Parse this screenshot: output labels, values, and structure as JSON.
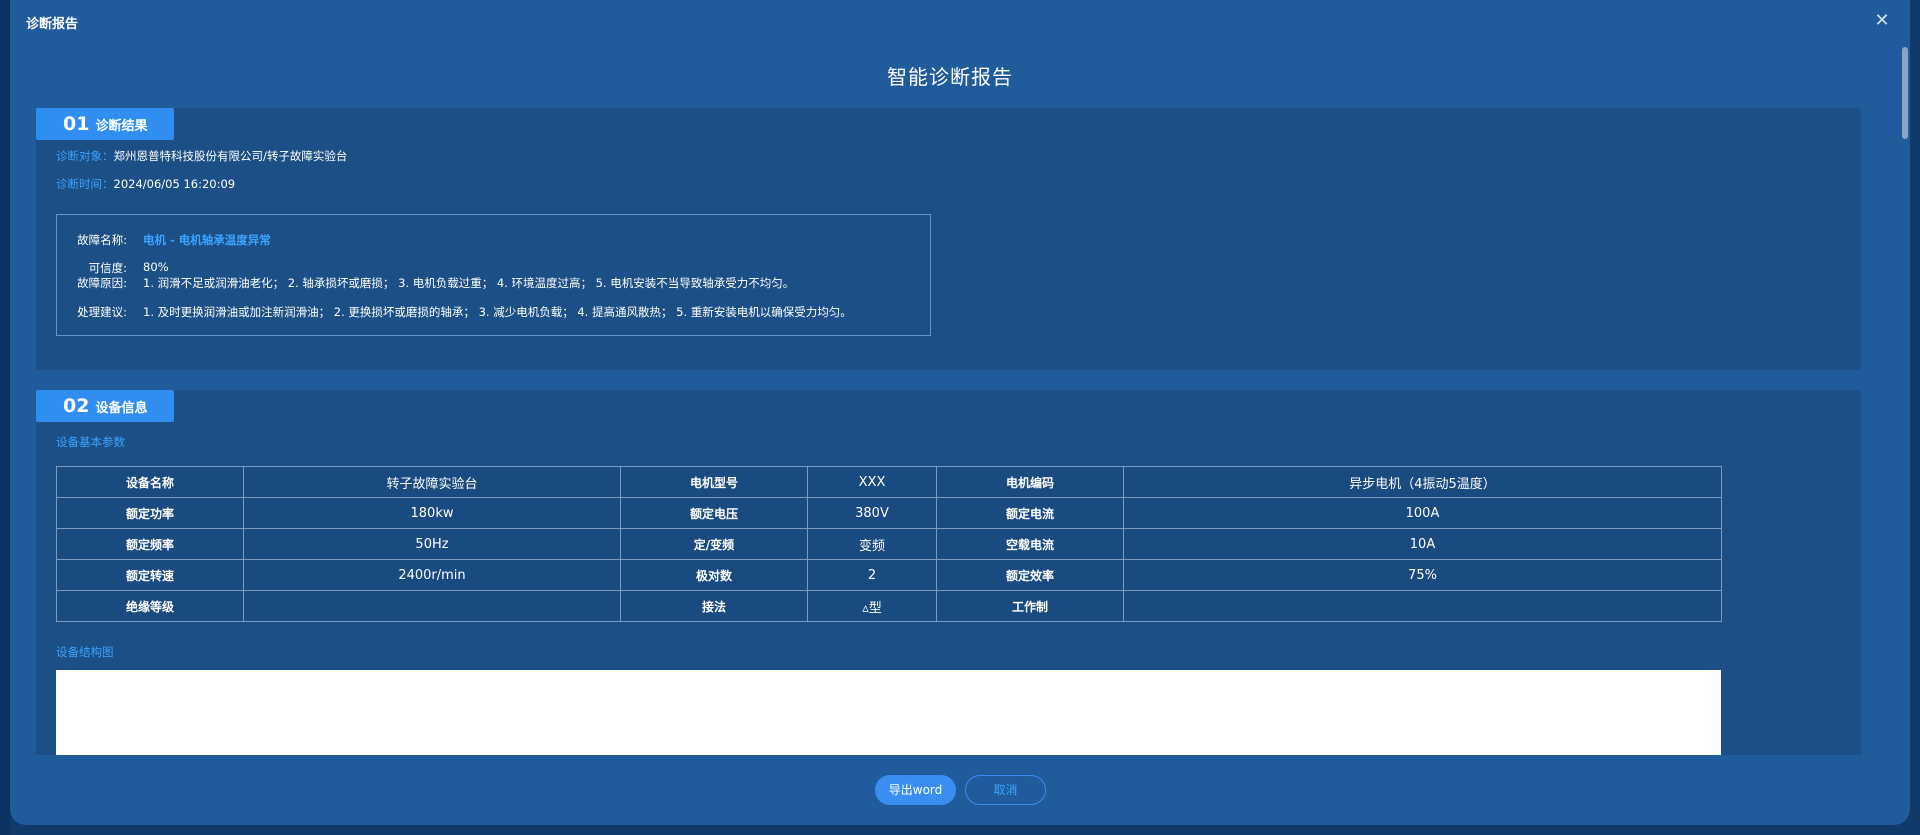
{
  "dialog": {
    "title": "诊断报告",
    "close_icon": "close-icon"
  },
  "report": {
    "title": "智能诊断报告"
  },
  "section1": {
    "num": "01",
    "label": "诊断结果",
    "object_key": "诊断对象：",
    "object_val": "郑州恩普特科技股份有限公司/转子故障实验台",
    "time_key": "诊断时间：",
    "time_val": "2024/06/05 16:20:09",
    "fault": {
      "name_key": "故障名称:",
      "name_val": "电机 - 电机轴承温度异常",
      "conf_key": "可信度:",
      "conf_val": "80%",
      "cause_key": "故障原因:",
      "cause_val": "1. 润滑不足或润滑油老化； 2. 轴承损坏或磨损； 3. 电机负载过重； 4. 环境温度过高； 5. 电机安装不当导致轴承受力不均匀。",
      "advice_key": "处理建议:",
      "advice_val": "1. 及时更换润滑油或加注新润滑油； 2. 更换损坏或磨损的轴承； 3. 减少电机负载； 4. 提高通风散热； 5. 重新安装电机以确保受力均匀。"
    }
  },
  "section2": {
    "num": "02",
    "label": "设备信息",
    "basic_params_title": "设备基本参数",
    "structure_title": "设备结构图",
    "table": [
      [
        "设备名称",
        "转子故障实验台",
        "电机型号",
        "XXX",
        "电机编码",
        "异步电机（4振动5温度）"
      ],
      [
        "额定功率",
        "180kw",
        "额定电压",
        "380V",
        "额定电流",
        "100A"
      ],
      [
        "额定频率",
        "50Hz",
        "定/变频",
        "变频",
        "空载电流",
        "10A"
      ],
      [
        "额定转速",
        "2400r/min",
        "极对数",
        "2",
        "额定效率",
        "75%"
      ],
      [
        "绝缘等级",
        "",
        "接法",
        "▵型",
        "工作制",
        ""
      ]
    ]
  },
  "footer": {
    "export_label": "导出word",
    "cancel_label": "取消"
  },
  "colors": {
    "accent": "#3ca3ff",
    "badge": "#2f8ef0",
    "modal_bg": "#205b9c",
    "section_bg": "#1b4f86"
  }
}
